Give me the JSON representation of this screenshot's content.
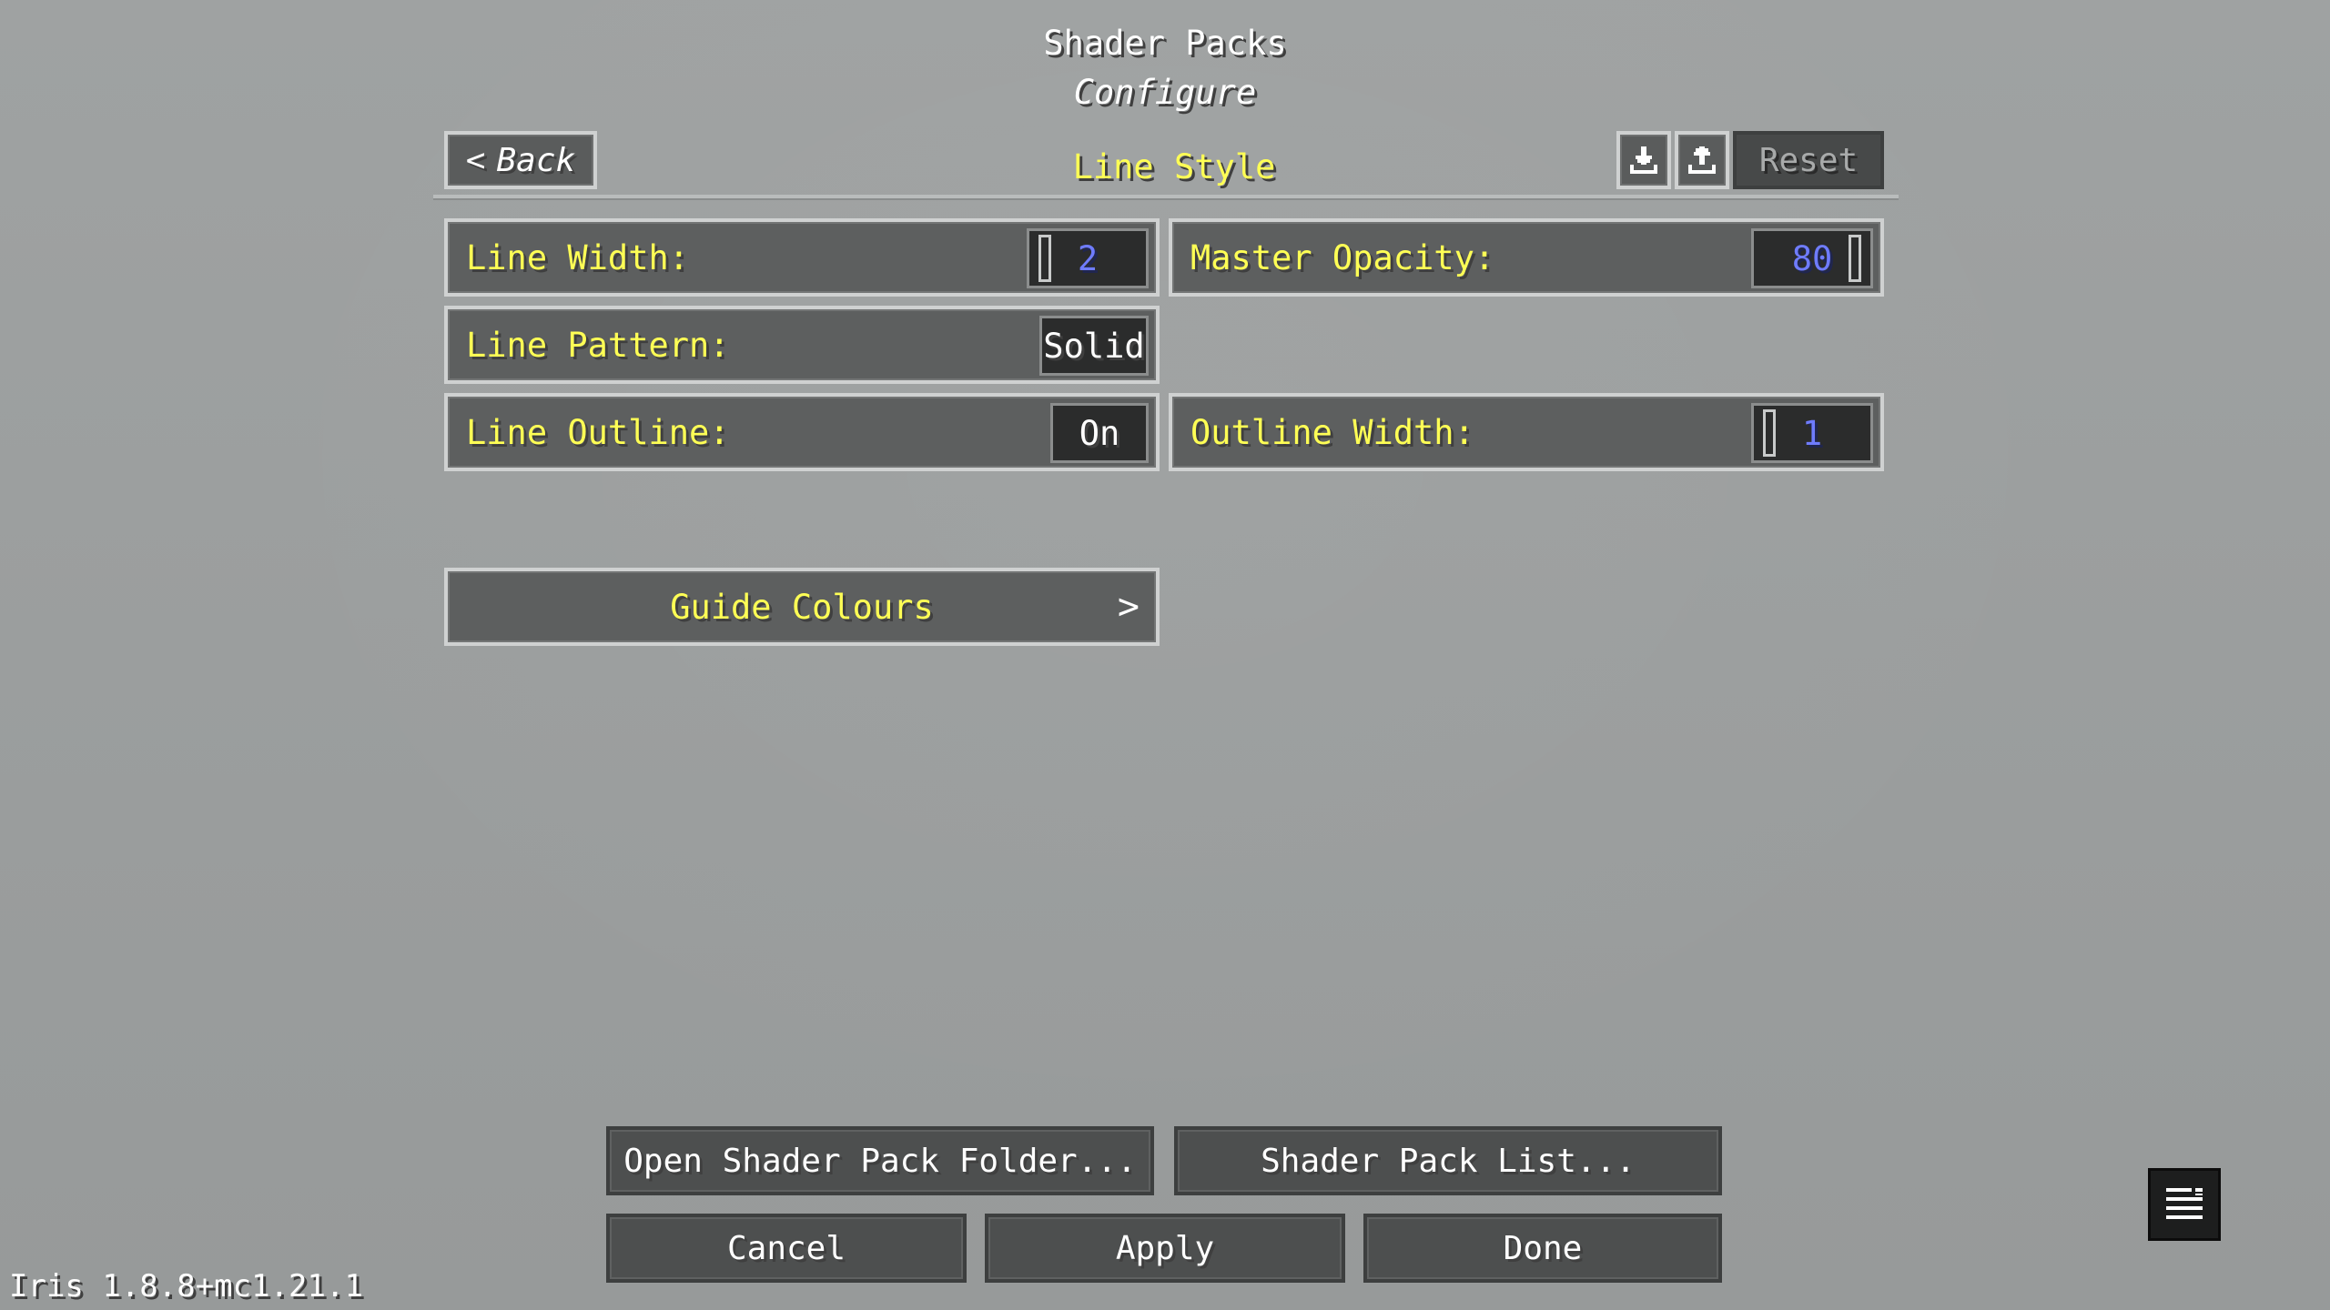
{
  "header": {
    "title": "Shader Packs",
    "subtitle": "Configure",
    "back_label": "Back",
    "section_title": "Line Style",
    "reset_label": "Reset",
    "import_icon": "import-icon",
    "export_icon": "export-icon"
  },
  "options": {
    "line_width": {
      "label": "Line Width:",
      "value": "2",
      "fraction": 0.0
    },
    "master_opacity": {
      "label": "Master Opacity:",
      "value": "80",
      "fraction": 1.0
    },
    "line_pattern": {
      "label": "Line Pattern:",
      "value": "Solid"
    },
    "line_outline": {
      "label": "Line Outline:",
      "value": "On"
    },
    "outline_width": {
      "label": "Outline Width:",
      "value": "1",
      "fraction": 0.0
    }
  },
  "guide_colours": {
    "label": "Guide Colours"
  },
  "footer": {
    "open_folder_label": "Open Shader Pack Folder...",
    "pack_list_label": "Shader Pack List...",
    "cancel_label": "Cancel",
    "apply_label": "Apply",
    "done_label": "Done"
  },
  "version": "Iris 1.8.8+mc1.21.1",
  "colors": {
    "label_yellow": "#ffff55",
    "value_blue": "#6f7cff",
    "background": "#9a9d9d"
  }
}
